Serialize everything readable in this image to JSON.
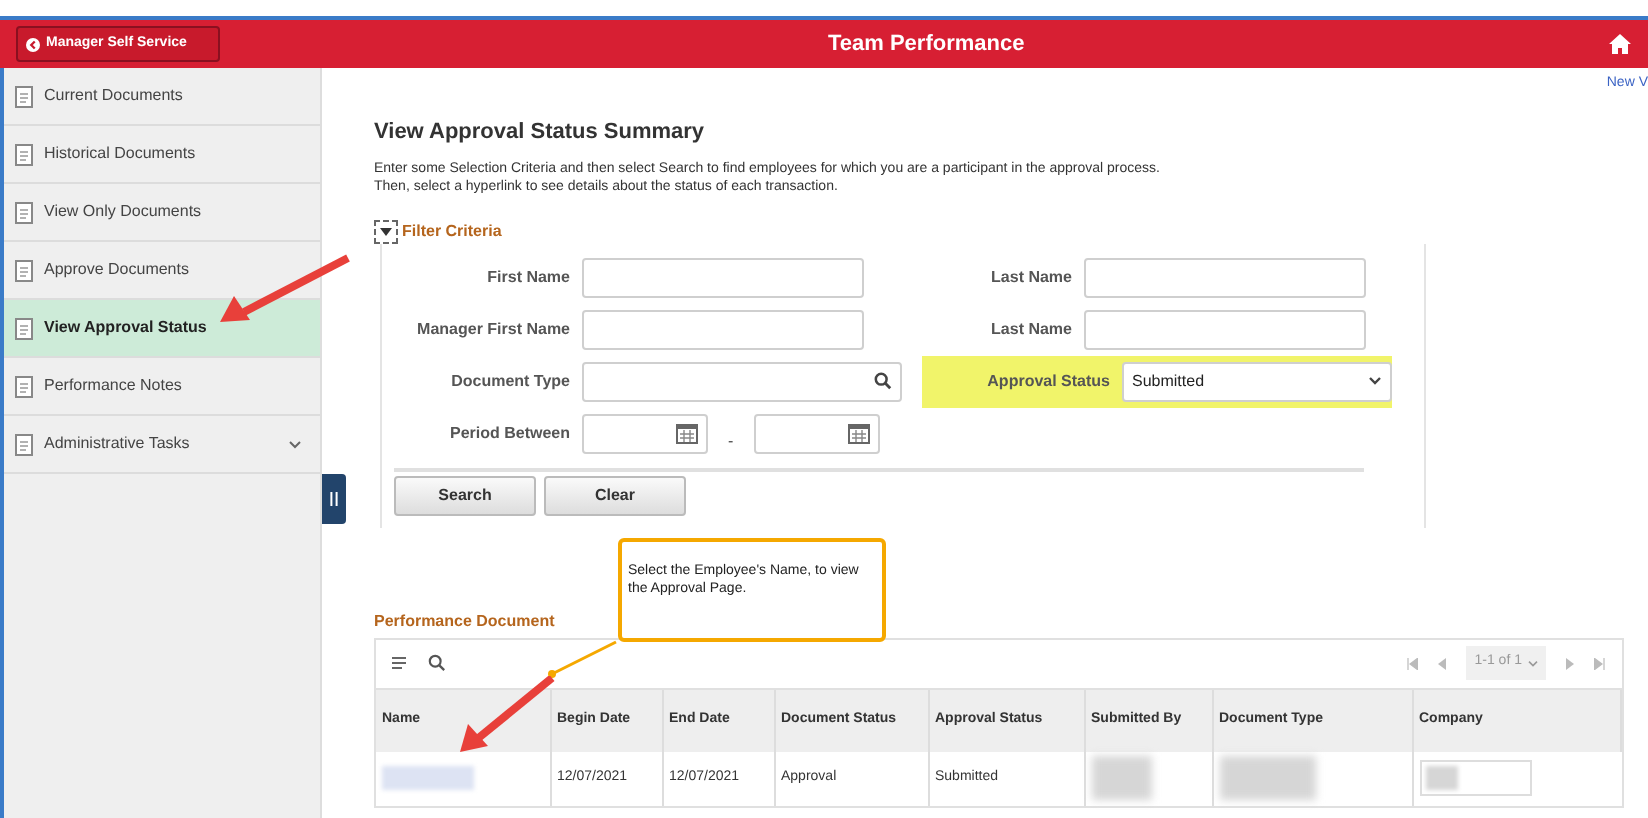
{
  "header": {
    "back_button": "Manager Self Service",
    "title": "Team Performance",
    "top_link": "New V"
  },
  "sidebar": {
    "items": [
      {
        "label": "Current Documents",
        "kind": "link",
        "selected": false
      },
      {
        "label": "Historical Documents",
        "kind": "link",
        "selected": false
      },
      {
        "label": "View Only Documents",
        "kind": "link",
        "selected": false
      },
      {
        "label": "Approve Documents",
        "kind": "link",
        "selected": false
      },
      {
        "label": "View Approval Status",
        "kind": "link",
        "selected": true
      },
      {
        "label": "Performance Notes",
        "kind": "link",
        "selected": false
      },
      {
        "label": "Administrative Tasks",
        "kind": "group",
        "selected": false
      }
    ]
  },
  "page": {
    "title": "View Approval Status Summary",
    "description": "Enter some Selection Criteria and then select Search to find employees for which you are a participant in the approval process. Then, select a hyperlink to see details about the status of each transaction.",
    "filter": {
      "title": "Filter Criteria",
      "expanded": true,
      "rows": [
        [
          {
            "label": "First Name",
            "kind": "text",
            "highlighted": false
          },
          {
            "label": "Last Name",
            "kind": "text",
            "highlighted": false
          }
        ],
        [
          {
            "label": "Manager First Name",
            "kind": "text",
            "highlighted": false
          },
          {
            "label": "Last Name",
            "kind": "text",
            "highlighted": false
          }
        ],
        [
          {
            "label": "Document Type",
            "kind": "lookup",
            "highlighted": false
          },
          {
            "label": "Approval Status",
            "kind": "select",
            "value": "Submitted",
            "highlighted": true
          }
        ],
        [
          {
            "label": "Period Between",
            "kind": "daterange",
            "separator": "-",
            "highlighted": false
          }
        ]
      ],
      "buttons": [
        "Search",
        "Clear"
      ]
    },
    "callout": "Select the Employee's Name, to view the Approval Page.",
    "grid": {
      "title": "Performance Document",
      "pager": "1-1 of 1",
      "columns": [
        "Name",
        "Begin Date",
        "End Date",
        "Document Status",
        "Approval Status",
        "Submitted By",
        "Document Type",
        "Company"
      ],
      "rows": [
        [
          "",
          "12/07/2021",
          "12/07/2021",
          "Approval",
          "Submitted",
          "",
          "",
          ""
        ]
      ]
    }
  }
}
